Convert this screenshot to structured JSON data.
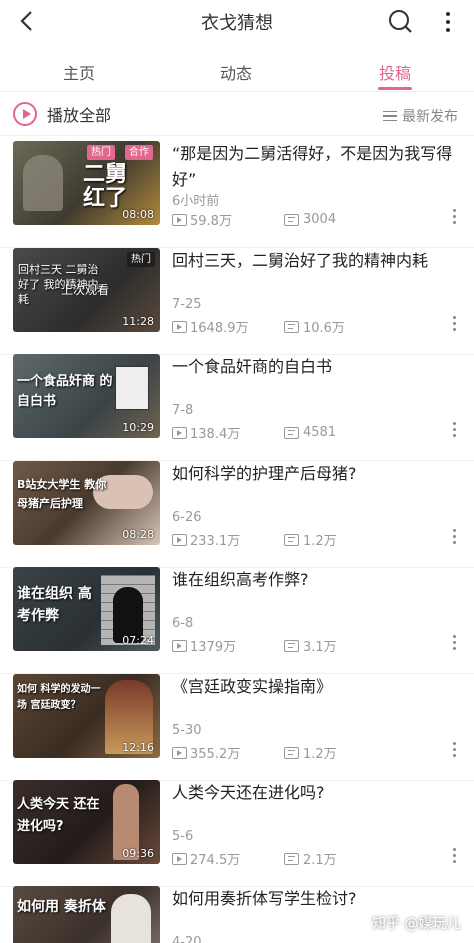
{
  "header": {
    "title": "衣戈猜想"
  },
  "tabs": [
    {
      "label": "主页"
    },
    {
      "label": "动态"
    },
    {
      "label": "投稿"
    }
  ],
  "toolbar": {
    "play_all": "播放全部",
    "sort": "最新发布"
  },
  "accent_color": "#e2668d",
  "videos": [
    {
      "title": "“那是因为二舅活得好，不是因为我写得好”",
      "date": "6小时前",
      "views": "59.8万",
      "danmaku": "3004",
      "duration": "08:08",
      "badges": [
        "热门",
        "合作"
      ],
      "thumb_text": "二舅 红了"
    },
    {
      "title": "回村三天，二舅治好了我的精神内耗",
      "date": "7-25",
      "views": "1648.9万",
      "danmaku": "10.6万",
      "duration": "11:28",
      "badges": [
        "热门"
      ],
      "thumb_text": "回村三天 二舅治好了 我的精神内耗",
      "overlay": "上次观看"
    },
    {
      "title": "一个食品奸商的自白书",
      "date": "7-8",
      "views": "138.4万",
      "danmaku": "4581",
      "duration": "10:29",
      "thumb_text": "一个食品奸商 的自白书"
    },
    {
      "title": "如何科学的护理产后母猪?",
      "date": "6-26",
      "views": "233.1万",
      "danmaku": "1.2万",
      "duration": "08:28",
      "thumb_text": "B站女大学生 教你 母猪产后护理"
    },
    {
      "title": "谁在组织高考作弊?",
      "date": "6-8",
      "views": "1379万",
      "danmaku": "3.1万",
      "duration": "07:24",
      "thumb_text": "谁在组织 高考作弊"
    },
    {
      "title": "《宫廷政变实操指南》",
      "date": "5-30",
      "views": "355.2万",
      "danmaku": "1.2万",
      "duration": "12:16",
      "thumb_text": "如何 科学的发动一场 宫廷政变？"
    },
    {
      "title": "人类今天还在进化吗?",
      "date": "5-6",
      "views": "274.5万",
      "danmaku": "2.1万",
      "duration": "09:36",
      "thumb_text": "人类今天 还在进化吗?"
    },
    {
      "title": "如何用奏折体写学生检讨?",
      "date": "4-20",
      "views": "",
      "danmaku": "",
      "duration": "",
      "thumb_text": "如何用 奏折体"
    }
  ],
  "watermark": "知乎 @媒玩儿"
}
